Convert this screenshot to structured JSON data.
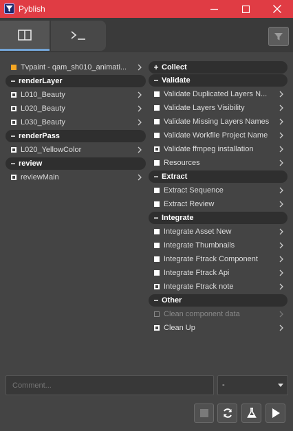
{
  "window": {
    "title": "Pyblish",
    "titlebar_color": "#e03c44",
    "icons": {
      "app": "pyblish-filter-icon",
      "minimize": "minimize-icon",
      "maximize": "maximize-icon",
      "close": "close-icon"
    }
  },
  "tabs": [
    {
      "name": "artist-view",
      "icon": "layout-panel-icon",
      "active": true
    },
    {
      "name": "terminal",
      "icon": "terminal-icon",
      "active": false
    }
  ],
  "instances": {
    "context": {
      "label": "Tvpaint - qam_sh010_animati...",
      "color": "#f5a623"
    },
    "groups": [
      {
        "label": "renderLayer",
        "items": [
          "L010_Beauty",
          "L020_Beauty",
          "L030_Beauty"
        ]
      },
      {
        "label": "renderPass",
        "items": [
          "L020_YellowColor"
        ]
      },
      {
        "label": "review",
        "items": [
          "reviewMain"
        ]
      }
    ]
  },
  "plugins": {
    "groups": [
      {
        "label": "Collect",
        "collapsed": true,
        "items": []
      },
      {
        "label": "Validate",
        "collapsed": false,
        "items": [
          {
            "label": "Validate Duplicated Layers N...",
            "state": "checked"
          },
          {
            "label": "Validate Layers Visibility",
            "state": "checked"
          },
          {
            "label": "Validate Missing Layers Names",
            "state": "checked"
          },
          {
            "label": "Validate Workfile Project Name",
            "state": "checked"
          },
          {
            "label": "Validate ffmpeg installation",
            "state": "hollow"
          },
          {
            "label": "Resources",
            "state": "checked"
          }
        ]
      },
      {
        "label": "Extract",
        "collapsed": false,
        "items": [
          {
            "label": "Extract Sequence",
            "state": "checked"
          },
          {
            "label": "Extract Review",
            "state": "checked"
          }
        ]
      },
      {
        "label": "Integrate",
        "collapsed": false,
        "items": [
          {
            "label": "Integrate Asset New",
            "state": "checked"
          },
          {
            "label": "Integrate Thumbnails",
            "state": "checked"
          },
          {
            "label": "Integrate Ftrack Component",
            "state": "checked"
          },
          {
            "label": "Integrate Ftrack Api",
            "state": "checked"
          },
          {
            "label": "Integrate Ftrack note",
            "state": "hollow"
          }
        ]
      },
      {
        "label": "Other",
        "collapsed": false,
        "items": [
          {
            "label": "Clean component data",
            "state": "disabled"
          },
          {
            "label": "Clean Up",
            "state": "hollow"
          }
        ]
      }
    ]
  },
  "footer": {
    "comment_placeholder": "Comment...",
    "combo_value": "-",
    "buttons": [
      "stop-icon",
      "reset-icon",
      "validate-flask-icon",
      "publish-play-icon"
    ]
  },
  "accent_color": "#73a4d6"
}
